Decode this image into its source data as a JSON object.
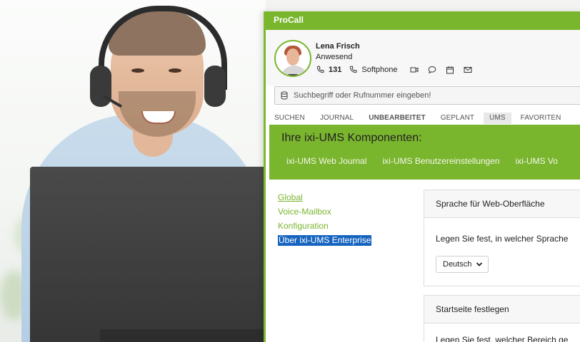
{
  "window": {
    "title": "ProCall"
  },
  "contact": {
    "name": "Lena Frisch",
    "presence": "Anwesend",
    "extension": "131",
    "phone_mode": "Softphone"
  },
  "search": {
    "placeholder": "Suchbegriff oder Rufnummer eingeben!"
  },
  "tabs": [
    {
      "label": "SUCHEN"
    },
    {
      "label": "JOURNAL"
    },
    {
      "label": "UNBEARBEITET"
    },
    {
      "label": "GEPLANT"
    },
    {
      "label": "UMS"
    },
    {
      "label": "FAVORITEN"
    }
  ],
  "ums": {
    "banner_title": "Ihre ixi-UMS Komponenten:",
    "links": [
      "ixi-UMS Web Journal",
      "ixi-UMS Benutzereinstellungen",
      "ixi-UMS Vo"
    ]
  },
  "sidenav": [
    "Global",
    "Voice-Mailbox",
    "Konfiguration",
    "Über ixi-UMS Enterprise"
  ],
  "panels": {
    "language": {
      "title": "Sprache für Web-Oberfläche",
      "text": "Legen Sie fest, in welcher Sprache",
      "selected": "Deutsch"
    },
    "startpage": {
      "title": "Startseite festlegen",
      "text": "Legen Sie fest, welcher Bereich ge"
    }
  },
  "colors": {
    "accent": "#7ab52e",
    "selection": "#1664c0"
  }
}
